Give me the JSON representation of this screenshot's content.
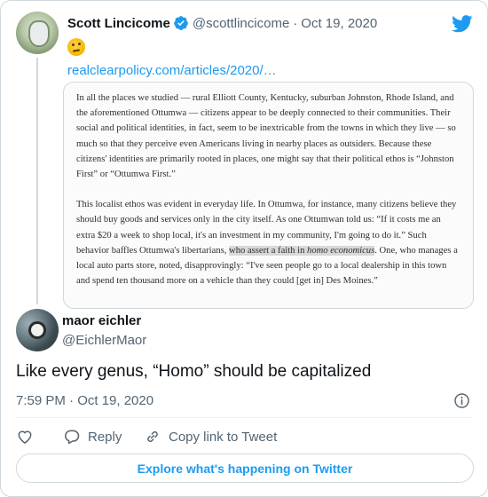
{
  "parent_tweet": {
    "author_name": "Scott Lincicome",
    "author_handle": "@scottlincicome",
    "separator": "·",
    "date": "Oct 19, 2020",
    "link_text": "realclearpolicy.com/articles/2020/…",
    "quoted_image": {
      "paragraph1": "In all the places we studied — rural Elliott County, Kentucky, suburban Johnston, Rhode Island, and the aforementioned Ottumwa — citizens appear to be deeply connected to their communities. Their social and political identities, in fact, seem to be inextricable from the towns in which they live — so much so that they perceive even Americans living in nearby places as outsiders. Because these citizens' identities are primarily rooted in places, one might say that their political ethos is “Johnston First” or “Ottumwa First.”",
      "paragraph2_before": "This localist ethos was evident in everyday life. In Ottumwa, for instance, many citizens believe they should buy goods and services only in the city itself. As one Ottumwan told us: “If it costs me an extra $20 a week to shop local, it's an investment in my community, I'm going to do it.” Such behavior baffles Ottumwa's libertarians, ",
      "paragraph2_highlight": "who assert a faith in ",
      "paragraph2_italic": "homo economicus",
      "paragraph2_after": ". One, who manages a local auto parts store, noted, disapprovingly: “I've seen people go to a local dealership in this town and spend ten thousand more on a vehicle than they could [get in] Des Moines.”"
    }
  },
  "main_tweet": {
    "author_name": "maor eichler",
    "author_handle": "@EichlerMaor",
    "text": "Like every genus, “Homo” should be capitalized",
    "timestamp": "7:59 PM · Oct 19, 2020"
  },
  "actions": {
    "reply_label": "Reply",
    "copy_label": "Copy link to Tweet"
  },
  "explore_label": "Explore what's happening on Twitter",
  "colors": {
    "accent": "#1d9bf0",
    "text": "#0f1419",
    "muted": "#536471",
    "border": "#cfd9de"
  }
}
